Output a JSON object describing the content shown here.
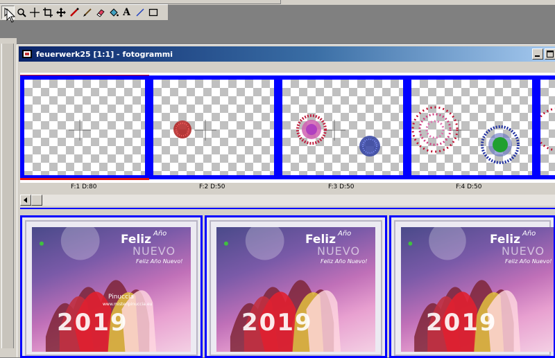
{
  "toolbar": {
    "tools": [
      {
        "name": "pointer-icon",
        "active": true
      },
      {
        "name": "zoom-icon"
      },
      {
        "name": "move-cross-icon"
      },
      {
        "name": "crop-icon"
      },
      {
        "name": "mover-icon"
      },
      {
        "name": "dropper-icon"
      },
      {
        "name": "brush-icon"
      },
      {
        "name": "eraser-icon"
      },
      {
        "name": "fill-icon"
      },
      {
        "name": "text-icon",
        "label": "A"
      },
      {
        "name": "line-icon"
      },
      {
        "name": "rectangle-icon"
      }
    ]
  },
  "window": {
    "title": "feuerwerk25 [1:1] - fotogrammi",
    "buttons": [
      "minimize",
      "maximize"
    ]
  },
  "frames": [
    {
      "label": "F:1   D:80"
    },
    {
      "label": "F:2   D:50"
    },
    {
      "label": "F:3   D:50"
    },
    {
      "label": "F:4   D:50"
    }
  ],
  "preview": {
    "feliz": "Feliz",
    "ano": "Año",
    "nuevo": "NUEVO",
    "subtitle": "Feliz Año Nuevo!",
    "watermark": "Pinuccia",
    "site": "www.misteripinuccia.eu",
    "year": "2019"
  },
  "colors": {
    "frame_border": "#0000ff",
    "selection": "#e01010",
    "title_start": "#0a246a",
    "title_end": "#a6caf0"
  }
}
